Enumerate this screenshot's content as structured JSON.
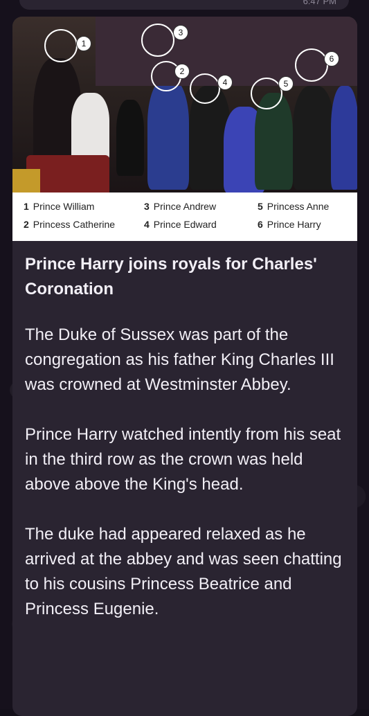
{
  "status": {
    "time": "6:47 PM"
  },
  "photo": {
    "markers": [
      "1",
      "2",
      "3",
      "4",
      "5",
      "6"
    ]
  },
  "legend": {
    "entries": [
      {
        "num": "1",
        "name": "Prince William"
      },
      {
        "num": "2",
        "name": "Princess Catherine"
      },
      {
        "num": "3",
        "name": "Prince Andrew"
      },
      {
        "num": "4",
        "name": "Prince Edward"
      },
      {
        "num": "5",
        "name": "Princess Anne"
      },
      {
        "num": "6",
        "name": "Prince Harry"
      }
    ]
  },
  "article": {
    "headline": "Prince Harry joins royals for Charles' Coronation",
    "paragraphs": [
      "The Duke of Sussex was part of the congregation as his father King Charles III was crowned at Westminster Abbey.",
      "Prince Harry watched intently from his seat in the third row as the crown was held above above the King's head.",
      "The duke had appeared relaxed as he arrived at the abbey and was seen chatting to his cousins Princess Beatrice and Princess Eugenie."
    ]
  }
}
